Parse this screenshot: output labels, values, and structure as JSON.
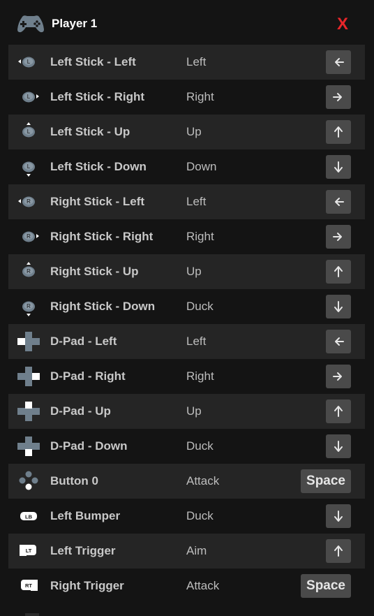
{
  "header": {
    "title": "Player 1",
    "close_label": "X",
    "icon": "gamepad-icon"
  },
  "colors": {
    "background": "#141414",
    "row_alt": "#252525",
    "key_bg": "#4a4a4a",
    "close": "#e8262a"
  },
  "bindings": [
    {
      "input": "Left Stick - Left",
      "action": "Left",
      "key": "arrow-left",
      "icon": "left-stick-left-icon"
    },
    {
      "input": "Left Stick - Right",
      "action": "Right",
      "key": "arrow-right",
      "icon": "left-stick-right-icon"
    },
    {
      "input": "Left Stick - Up",
      "action": "Up",
      "key": "arrow-up",
      "icon": "left-stick-up-icon"
    },
    {
      "input": "Left Stick - Down",
      "action": "Down",
      "key": "arrow-down",
      "icon": "left-stick-down-icon"
    },
    {
      "input": "Right Stick - Left",
      "action": "Left",
      "key": "arrow-left",
      "icon": "right-stick-left-icon"
    },
    {
      "input": "Right Stick - Right",
      "action": "Right",
      "key": "arrow-right",
      "icon": "right-stick-right-icon"
    },
    {
      "input": "Right Stick - Up",
      "action": "Up",
      "key": "arrow-up",
      "icon": "right-stick-up-icon"
    },
    {
      "input": "Right Stick - Down",
      "action": "Duck",
      "key": "arrow-down",
      "icon": "right-stick-down-icon"
    },
    {
      "input": "D-Pad - Left",
      "action": "Left",
      "key": "arrow-left",
      "icon": "dpad-left-icon"
    },
    {
      "input": "D-Pad - Right",
      "action": "Right",
      "key": "arrow-right",
      "icon": "dpad-right-icon"
    },
    {
      "input": "D-Pad - Up",
      "action": "Up",
      "key": "arrow-up",
      "icon": "dpad-up-icon"
    },
    {
      "input": "D-Pad - Down",
      "action": "Duck",
      "key": "arrow-down",
      "icon": "dpad-down-icon"
    },
    {
      "input": "Button 0",
      "action": "Attack",
      "key": "Space",
      "icon": "face-button-bottom-icon"
    },
    {
      "input": "Left Bumper",
      "action": "Duck",
      "key": "arrow-down",
      "icon": "left-bumper-icon"
    },
    {
      "input": "Left Trigger",
      "action": "Aim",
      "key": "arrow-up",
      "icon": "left-trigger-icon"
    },
    {
      "input": "Right Trigger",
      "action": "Attack",
      "key": "Space",
      "icon": "right-trigger-icon"
    }
  ]
}
